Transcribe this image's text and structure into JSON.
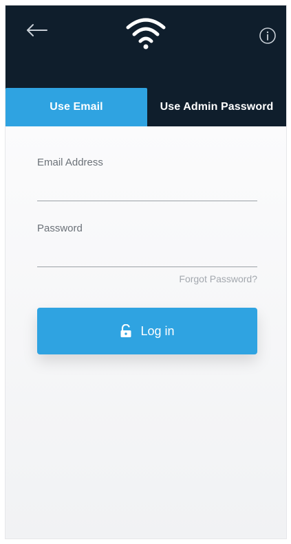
{
  "header": {
    "back_icon": "arrow-left-icon",
    "logo_icon": "wifi-icon",
    "info_icon": "info-circle-icon"
  },
  "tabs": [
    {
      "label": "Use Email",
      "active": true
    },
    {
      "label": "Use Admin Password",
      "active": false
    }
  ],
  "form": {
    "email": {
      "label": "Email Address",
      "value": "",
      "placeholder": ""
    },
    "password": {
      "label": "Password",
      "value": "",
      "placeholder": ""
    },
    "forgot_label": "Forgot Password?",
    "login_label": "Log in",
    "login_icon": "unlock-icon"
  },
  "colors": {
    "header_bg": "#0f1e2c",
    "accent": "#2fa3e1",
    "background": "#f4f5f7",
    "muted_text": "#a3a8ae"
  }
}
